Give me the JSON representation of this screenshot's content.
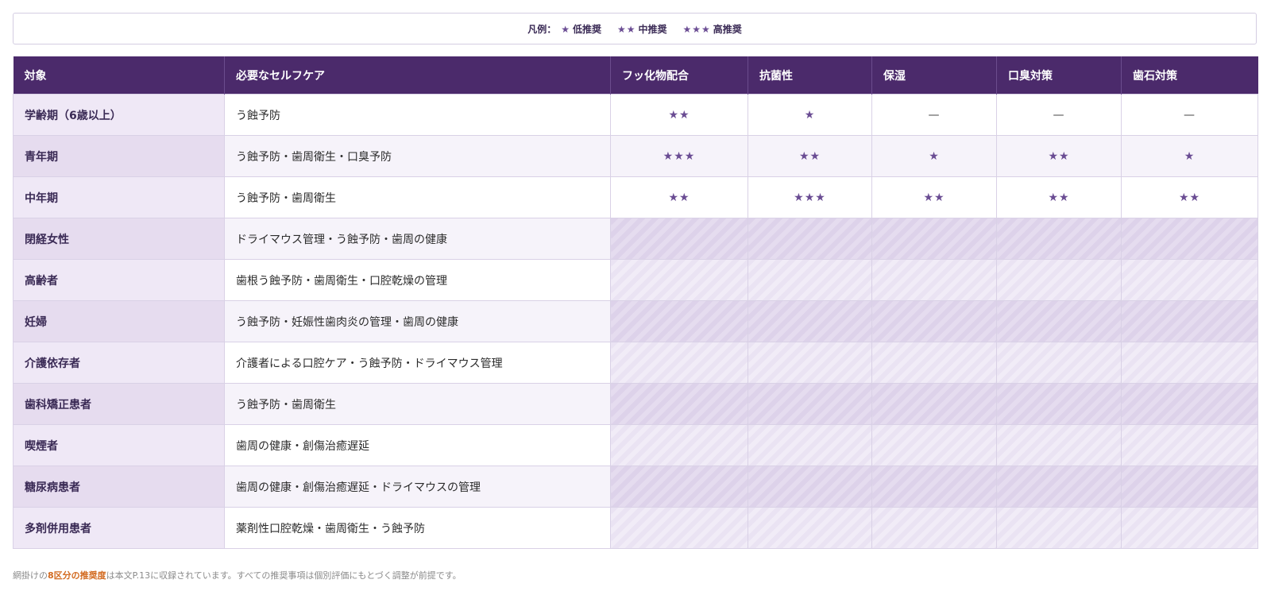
{
  "legend": {
    "prefix": "凡例：",
    "items": [
      {
        "stars": "★",
        "label": "低推奨"
      },
      {
        "stars": "★★",
        "label": "中推奨"
      },
      {
        "stars": "★★★",
        "label": "高推奨"
      }
    ]
  },
  "table": {
    "headers": [
      "対象",
      "必要なセルフケア",
      "フッ化物配合",
      "抗菌性",
      "保湿",
      "口臭対策",
      "歯石対策"
    ],
    "rows": [
      {
        "target": "学齢期（6歳以上）",
        "care": "う蝕予防",
        "ratings": [
          "★★",
          "★",
          "—",
          "—",
          "—"
        ]
      },
      {
        "target": "青年期",
        "care": "う蝕予防・歯周衛生・口臭予防",
        "ratings": [
          "★★★",
          "★★",
          "★",
          "★★",
          "★"
        ]
      },
      {
        "target": "中年期",
        "care": "う蝕予防・歯周衛生",
        "ratings": [
          "★★",
          "★★★",
          "★★",
          "★★",
          "★★"
        ]
      },
      {
        "target": "閉経女性",
        "care": "ドライマウス管理・う蝕予防・歯周の健康"
      },
      {
        "target": "高齢者",
        "care": "歯根う蝕予防・歯周衛生・口腔乾燥の管理"
      },
      {
        "target": "妊婦",
        "care": "う蝕予防・妊娠性歯肉炎の管理・歯周の健康"
      },
      {
        "target": "介護依存者",
        "care": "介護者による口腔ケア・う蝕予防・ドライマウス管理"
      },
      {
        "target": "歯科矯正患者",
        "care": "う蝕予防・歯周衛生"
      },
      {
        "target": "喫煙者",
        "care": "歯周の健康・創傷治癒遅延"
      },
      {
        "target": "糖尿病患者",
        "care": "歯周の健康・創傷治癒遅延・ドライマウスの管理"
      },
      {
        "target": "多剤併用患者",
        "care": "薬剤性口腔乾燥・歯周衛生・う蝕予防"
      }
    ]
  },
  "footnote": {
    "before": "網掛けの",
    "highlight": "8区分の推奨度",
    "after": "は本文P.13に収録されています。すべての推奨事項は個別評価にもとづく調整が前提です。"
  }
}
